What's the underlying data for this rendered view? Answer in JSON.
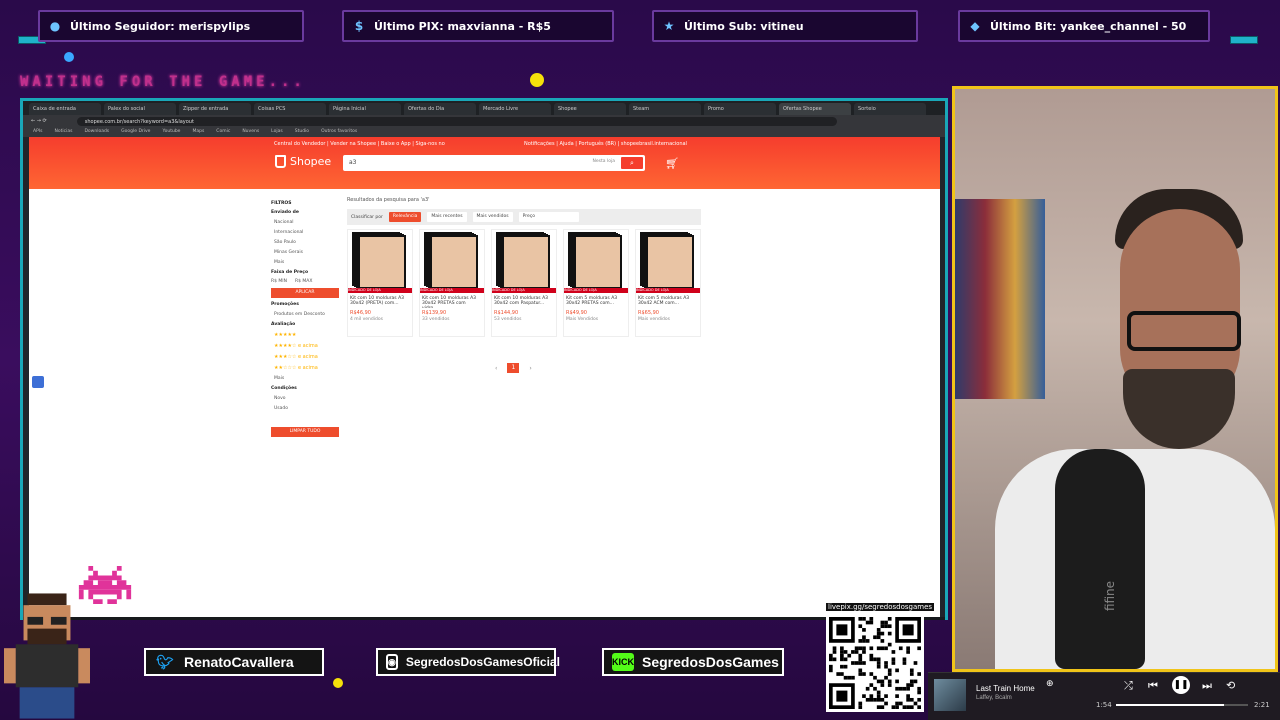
{
  "alerts": {
    "follower": "Último Seguidor: merispylips",
    "pix": "Último PIX: maxvianna - R$5",
    "sub": "Último Sub: vitineu",
    "bit": "Último Bit: yankee_channel - 50"
  },
  "waiting_text": "WAITING FOR THE GAME...",
  "browser": {
    "tabs": [
      "Caixa de entrada",
      "Palex do social",
      "Zipper de entrada",
      "Coisas PCS",
      "Página Inicial",
      "Ofertas do Dia",
      "Mercado Livre",
      "Shopee",
      "Steam",
      "Promo",
      "Ofertas Shopee",
      "Sorteio"
    ],
    "url": "shopee.com.br/search?keyword=a3&layout",
    "bookmarks": [
      "APIs",
      "Noticias",
      "Downloads",
      "Google Drive",
      "Youtube",
      "Maps",
      "Comic",
      "Nuvens",
      "Lojas",
      "Studio",
      "Outros favoritos"
    ]
  },
  "shopee": {
    "top_left": "Central do Vendedor | Vender na Shopee | Baixe o App | Siga-nos no",
    "top_right": "Notificações | Ajuda | Português (BR) | shopeebrasil.internacional",
    "logo": "Shopee",
    "search_value": "a3",
    "search_option": "Nesta loja",
    "results_info": "Resultados da pesquisa para 'a3'",
    "sort_label": "Classificar por",
    "sort_options": [
      "Relevância",
      "Mais recentes",
      "Mais vendidos",
      "Preço"
    ],
    "filters": {
      "title": "FILTROS",
      "location_title": "Enviado de",
      "locations": [
        "Nacional",
        "Internacional",
        "São Paulo",
        "Minas Gerais",
        "Mais"
      ],
      "price_title": "Faixa de Preço",
      "price_min": "R$ MIN",
      "price_max": "R$ MAX",
      "apply": "APLICAR",
      "promo_title": "Promoções",
      "promo_item": "Produtos em Desconto",
      "rating_title": "Avaliação",
      "ratings": [
        "★★★★★",
        "★★★★☆ e acima",
        "★★★☆☆ e acima",
        "★★☆☆☆ e acima"
      ],
      "rating_more": "Mais",
      "cond_title": "Condições",
      "conditions": [
        "Novo",
        "Usado"
      ],
      "clear": "LIMPAR TUDO"
    },
    "products": [
      {
        "name": "Kit com 10 molduras A3 30x42 (PRETA) com...",
        "price": "R$46,90",
        "sold": "4 mil vendidos"
      },
      {
        "name": "Kit com 10 molduras A3 30x42 PRETAS com vidro...",
        "price": "R$139,90",
        "sold": "33 vendidos"
      },
      {
        "name": "Kit com 10 molduras A3 30x42 com Paspatur...",
        "price": "R$144,90",
        "sold": "53 vendidos"
      },
      {
        "name": "Kit com 5 molduras A3 30x42 PRETAS com...",
        "price": "R$49,90",
        "sold": "Mais Vendidos"
      },
      {
        "name": "Kit com 5 molduras A3 30x42 ACM com...",
        "price": "R$65,90",
        "sold": "Mais vendidos"
      }
    ],
    "product_tag": "INDICADO DE LOJA",
    "page_current": "1"
  },
  "socials": {
    "twitter": "RenatoCavallera",
    "instagram": "SegredosDosGamesOficial",
    "kick": "SegredosDosGames",
    "kick_badge": "KICK"
  },
  "qr_label": "livepix.gg/segredosdosgames",
  "cam_brand": "fifine",
  "player": {
    "title": "Last Train Home",
    "artist": "Laffey, Bcalm",
    "time_elapsed": "1:54",
    "time_total": "2:21",
    "progress": 0.82
  },
  "colors": {
    "accent_cyan": "#1fb3c9",
    "accent_yellow": "#f0c419",
    "shopee_orange": "#ee4d2d",
    "waiting_pink": "#c0308c"
  }
}
